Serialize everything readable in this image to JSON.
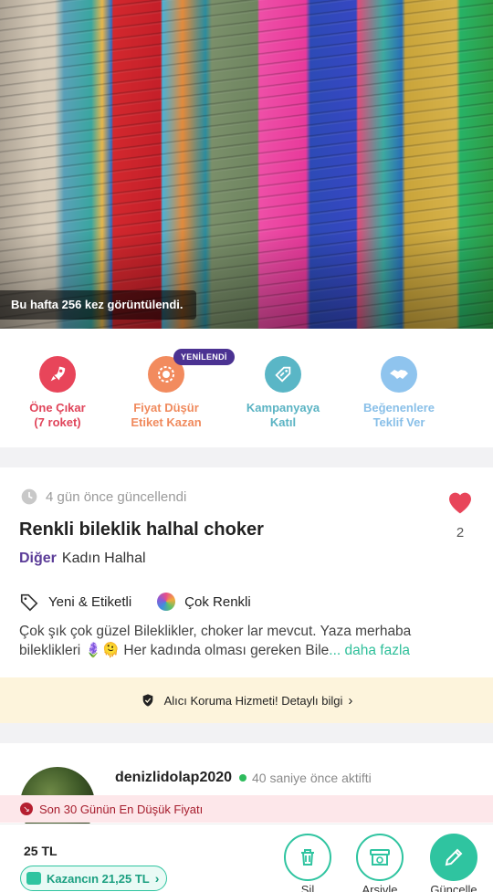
{
  "hero": {
    "view_count_text": "Bu hafta 256 kez görüntülendi."
  },
  "actions": [
    {
      "line1": "Öne Çıkar",
      "line2": "(7 roket)",
      "icon": "rocket-icon"
    },
    {
      "line1": "Fiyat Düşür",
      "line2": "Etiket Kazan",
      "icon": "price-tag-icon"
    },
    {
      "line1": "Kampanyaya",
      "line2": "Katıl",
      "icon": "campaign-tag-icon"
    },
    {
      "line1": "Beğenenlere",
      "line2": "Teklif Ver",
      "icon": "handshake-icon"
    }
  ],
  "new_badge": "YENİLENDİ",
  "details": {
    "updated": "4 gün önce güncellendi",
    "like_count": "2",
    "title": "Renkli bileklik halhal choker",
    "category_main": "Diğer",
    "category_sub": "Kadın Halhal",
    "condition": "Yeni & Etiketli",
    "color": "Çok Renkli",
    "description_line1": "Çok şık çok güzel Bileklikler, choker lar mevcut. Yaza merhaba",
    "description_line2": "bileklikleri 🪻🫠 Her kadında olması gereken Bile",
    "more": "... daha fazla"
  },
  "protection": {
    "text": "Alıcı Koruma Hizmeti! Detaylı bilgi"
  },
  "seller": {
    "name": "denizlidolap2020",
    "activity": "40 saniye önce aktifti"
  },
  "lowest_price_banner": "Son 30 Günün En Düşük Fiyatı",
  "bottom": {
    "price": "25 TL",
    "earn": "Kazancın 21,25 TL",
    "delete": "Sil",
    "archive": "Arşivle",
    "update": "Güncelle"
  },
  "colors": {
    "accent": "#2fc4a0",
    "brand_purple": "#5b3c98",
    "like_red": "#e8455a"
  }
}
